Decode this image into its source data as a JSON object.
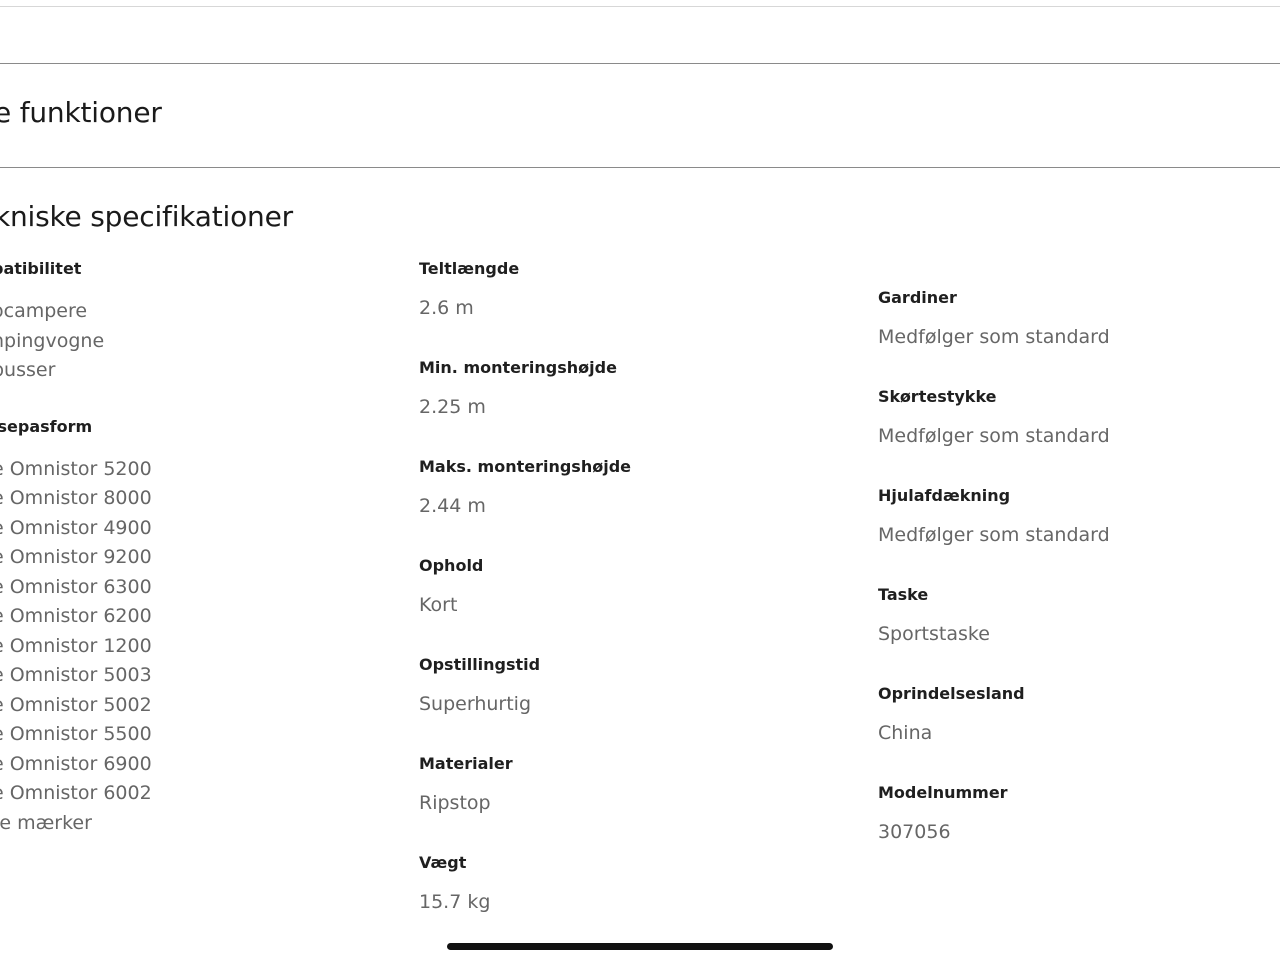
{
  "sections": {
    "features_heading": "e funktioner",
    "specs_heading": "kniske specifikationer"
  },
  "specs": {
    "compatibility": {
      "label": "patibilitet",
      "values": [
        "ocampere",
        "npingvogne",
        "busser"
      ]
    },
    "awning_fit": {
      "label": "isepasform",
      "values": [
        "e Omnistor 5200",
        "e Omnistor 8000",
        "e Omnistor 4900",
        "e Omnistor 9200",
        "e Omnistor 6300",
        "e Omnistor 6200",
        "e Omnistor 1200",
        "e Omnistor 5003",
        "e Omnistor 5002",
        "e Omnistor 5500",
        "e Omnistor 6900",
        "e Omnistor 6002",
        "re mærker"
      ]
    },
    "tent_length": {
      "label": "Teltlængde",
      "value": "2.6 m"
    },
    "min_mount_height": {
      "label": "Min. monteringshøjde",
      "value": "2.25 m"
    },
    "max_mount_height": {
      "label": "Maks. monteringshøjde",
      "value": "2.44 m"
    },
    "stay": {
      "label": "Ophold",
      "value": "Kort"
    },
    "setup_time": {
      "label": "Opstillingstid",
      "value": "Superhurtig"
    },
    "materials": {
      "label": "Materialer",
      "value": "Ripstop"
    },
    "weight": {
      "label": "Vægt",
      "value": "15.7 kg"
    },
    "curtains": {
      "label": "Gardiner",
      "value": "Medfølger som standard"
    },
    "skirt": {
      "label": "Skørtestykke",
      "value": "Medfølger som standard"
    },
    "wheel_cover": {
      "label": "Hjulafdækning",
      "value": "Medfølger som standard"
    },
    "bag": {
      "label": "Taske",
      "value": "Sportstaske"
    },
    "origin": {
      "label": "Oprindelsesland",
      "value": "China"
    },
    "model_number": {
      "label": "Modelnummer",
      "value": "307056"
    }
  }
}
